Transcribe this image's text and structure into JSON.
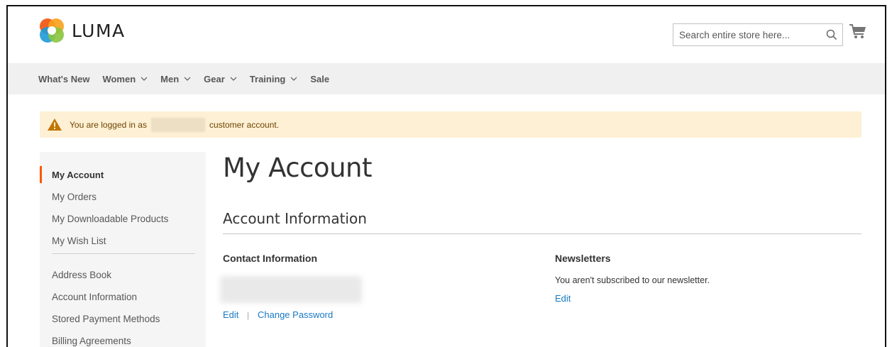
{
  "header": {
    "logo_text": "LUMA",
    "search_placeholder": "Search entire store here...",
    "cart_icon": "cart-icon",
    "search_icon": "search-icon"
  },
  "nav": {
    "items": [
      {
        "label": "What's New",
        "has_dropdown": false
      },
      {
        "label": "Women",
        "has_dropdown": true
      },
      {
        "label": "Men",
        "has_dropdown": true
      },
      {
        "label": "Gear",
        "has_dropdown": true
      },
      {
        "label": "Training",
        "has_dropdown": true
      },
      {
        "label": "Sale",
        "has_dropdown": false
      }
    ]
  },
  "notice": {
    "prefix": "You are logged in as",
    "suffix": "customer account."
  },
  "sidebar": {
    "items": [
      {
        "label": "My Account",
        "active": true
      },
      {
        "label": "My Orders"
      },
      {
        "label": "My Downloadable Products"
      },
      {
        "label": "My Wish List"
      },
      {
        "label": "Address Book"
      },
      {
        "label": "Account Information"
      },
      {
        "label": "Stored Payment Methods"
      },
      {
        "label": "Billing Agreements"
      }
    ]
  },
  "main": {
    "page_title": "My Account",
    "block_title": "Account Information",
    "contact": {
      "title": "Contact Information",
      "edit": "Edit",
      "separator": "|",
      "change_password": "Change Password"
    },
    "newsletters": {
      "title": "Newsletters",
      "text": "You aren't subscribed to our newsletter.",
      "edit": "Edit"
    }
  },
  "colors": {
    "accent": "#ff5501",
    "link": "#1979c3",
    "notice_bg": "#fdf0d5",
    "nav_bg": "#f0f0f0",
    "sidebar_bg": "#f5f5f5"
  }
}
